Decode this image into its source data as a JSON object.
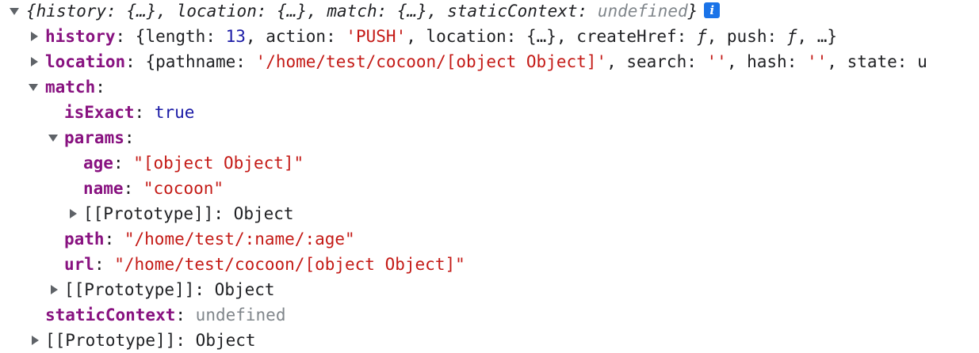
{
  "root": {
    "preview_open": "{",
    "k_history": "history",
    "k_location": "location",
    "k_match": "match",
    "k_static": "staticContext",
    "v_ellipsis": "{…}",
    "v_undefined": "undefined",
    "preview_close": "}",
    "info_icon": "i"
  },
  "history": {
    "key": "history",
    "k_length": "length",
    "v_length": "13",
    "k_action": "action",
    "v_action": "'PUSH'",
    "k_location": "location",
    "v_location": "{…}",
    "k_createHref": "createHref",
    "v_fn": "ƒ",
    "k_push": "push",
    "more": "…"
  },
  "location": {
    "key": "location",
    "k_pathname": "pathname",
    "v_pathname": "'/home/test/cocoon/[object Object]'",
    "k_search": "search",
    "v_search": "''",
    "k_hash": "hash",
    "v_hash": "''",
    "k_state": "state",
    "v_state_trunc": "u"
  },
  "match": {
    "key": "match",
    "isExact": {
      "key": "isExact",
      "value": "true"
    },
    "params": {
      "key": "params",
      "age": {
        "key": "age",
        "value": "\"[object Object]\""
      },
      "name": {
        "key": "name",
        "value": "\"cocoon\""
      },
      "proto": {
        "key": "[[Prototype]]",
        "value": "Object"
      }
    },
    "path": {
      "key": "path",
      "value": "\"/home/test/:name/:age\""
    },
    "url": {
      "key": "url",
      "value": "\"/home/test/cocoon/[object Object]\""
    },
    "proto": {
      "key": "[[Prototype]]",
      "value": "Object"
    }
  },
  "staticContext": {
    "key": "staticContext",
    "value": "undefined"
  },
  "proto": {
    "key": "[[Prototype]]",
    "value": "Object"
  }
}
